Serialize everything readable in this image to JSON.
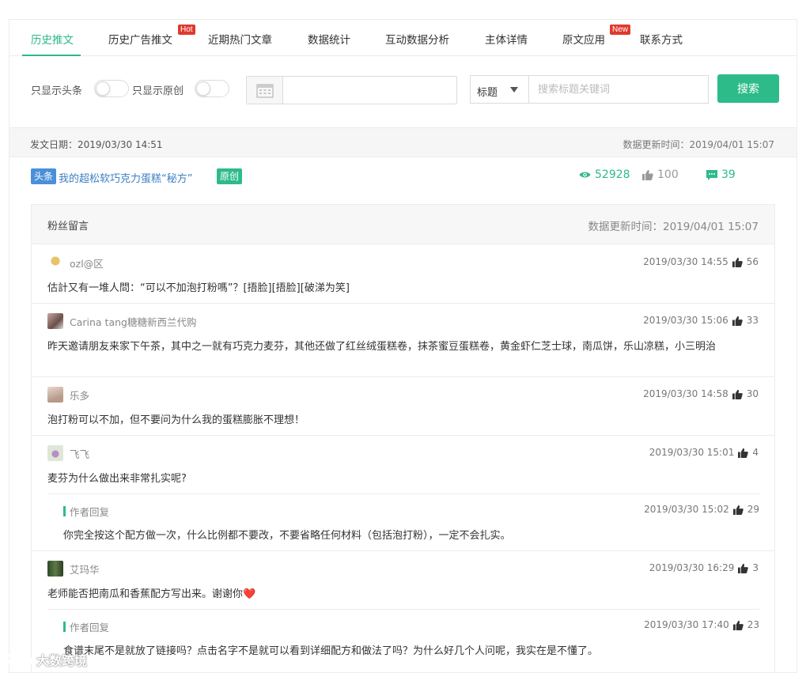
{
  "tabs": [
    {
      "label": "历史推文",
      "active": true
    },
    {
      "label": "历史广告推文",
      "badge": "Hot"
    },
    {
      "label": "近期热门文章"
    },
    {
      "label": "数据统计"
    },
    {
      "label": "互动数据分析"
    },
    {
      "label": "主体详情"
    },
    {
      "label": "原文应用",
      "badge": "New"
    },
    {
      "label": "联系方式"
    }
  ],
  "filters": {
    "headline_only": "只显示头条",
    "original_only": "只显示原创",
    "select_value": "标题",
    "search_placeholder": "搜索标题关键词",
    "search_button": "搜索"
  },
  "post": {
    "publish_date": "发文日期：2019/03/30 14:51",
    "data_updated": "数据更新时间：2019/04/01 15:07",
    "tag_headline": "头条",
    "title": "我的超松软巧克力蛋糕“秘方”",
    "tag_original": "原创",
    "views": "52928",
    "likes": "100",
    "comments": "39"
  },
  "comments_panel": {
    "title": "粉丝留言",
    "updated": "数据更新时间：2019/04/01 15:07",
    "items": [
      {
        "user": "ozl@区",
        "time": "2019/03/30 14:55",
        "likes": "56",
        "text": "估計又有一堆人問：“可以不加泡打粉嗎”？[捂脸][捂脸][破涕为笑]"
      },
      {
        "user": "Carina tang糖糖新西兰代购",
        "time": "2019/03/30 15:06",
        "likes": "33",
        "text": "昨天邀请朋友来家下午茶，其中之一就有巧克力麦芬，其他还做了红丝绒蛋糕卷，抹茶蜜豆蛋糕卷，黄金虾仁芝士球，南瓜饼，乐山凉糕，小三明治"
      },
      {
        "user": "乐多",
        "time": "2019/03/30 14:58",
        "likes": "30",
        "text": "泡打粉可以不加，但不要问为什么我的蛋糕膨胀不理想！"
      },
      {
        "user": "飞飞",
        "time": "2019/03/30 15:01",
        "likes": "4",
        "text": "麦芬为什么做出来非常扎实呢?",
        "reply": {
          "label": "作者回复",
          "time": "2019/03/30 15:02",
          "likes": "29",
          "text": "你完全按这个配方做一次，什么比例都不要改，不要省略任何材料（包括泡打粉），一定不会扎实。"
        }
      },
      {
        "user": "艾玛华",
        "time": "2019/03/30 16:29",
        "likes": "3",
        "text": "老师能否把南瓜和香蕉配方写出来。谢谢你❤️",
        "reply": {
          "label": "作者回复",
          "time": "2019/03/30 17:40",
          "likes": "23",
          "text": "食谱末尾不是就放了链接吗？点击名字不是就可以看到详细配方和做法了吗？为什么好几个人问呢，我实在是不懂了。"
        }
      }
    ]
  },
  "watermark": "大数跨境",
  "colors": {
    "accent": "#2dbb8a",
    "link": "#3c7fc4",
    "badge": "#e0392d",
    "headline_tag": "#4a90d9"
  }
}
